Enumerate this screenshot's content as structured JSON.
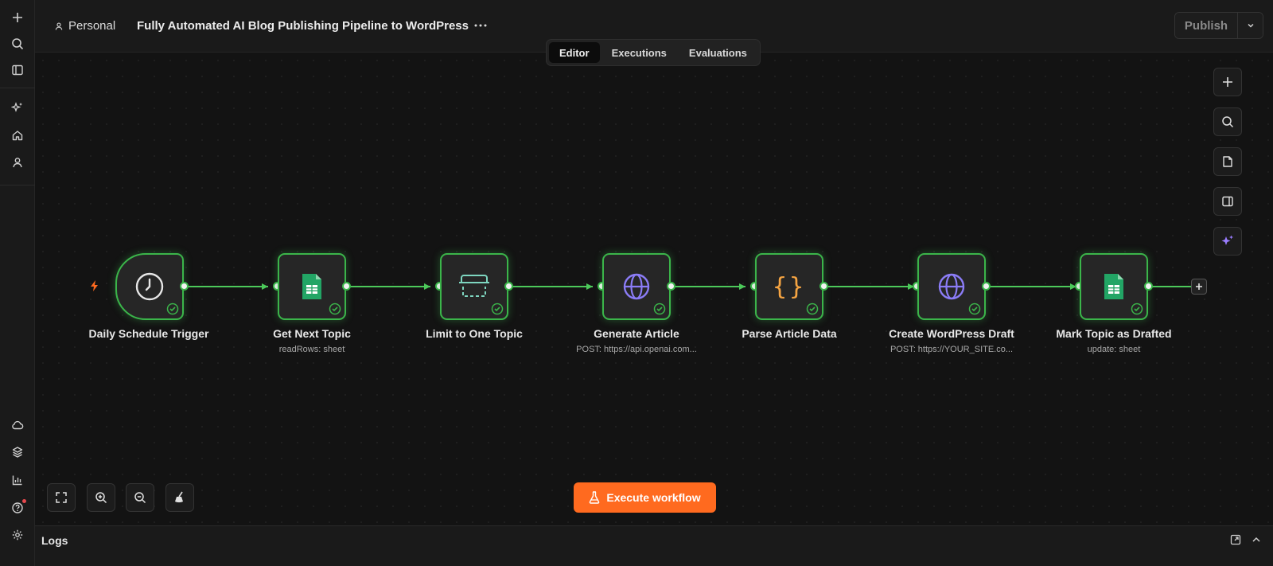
{
  "header": {
    "project_label": "Personal",
    "workflow_title": "Fully Automated AI Blog Publishing Pipeline to WordPress",
    "publish_label": "Publish"
  },
  "tabs": [
    {
      "label": "Editor",
      "active": true
    },
    {
      "label": "Executions",
      "active": false
    },
    {
      "label": "Evaluations",
      "active": false
    }
  ],
  "nodes": [
    {
      "label": "Daily Schedule Trigger",
      "subtitle": "",
      "icon": "clock-icon",
      "status": "success"
    },
    {
      "label": "Get Next Topic",
      "subtitle": "readRows: sheet",
      "icon": "google-sheets-icon",
      "status": "success"
    },
    {
      "label": "Limit to One Topic",
      "subtitle": "",
      "icon": "limit-icon",
      "status": "success"
    },
    {
      "label": "Generate Article",
      "subtitle": "POST: https://api.openai.com...",
      "icon": "globe-icon",
      "status": "success"
    },
    {
      "label": "Parse Article Data",
      "subtitle": "",
      "icon": "code-braces-icon",
      "status": "success"
    },
    {
      "label": "Create WordPress Draft",
      "subtitle": "POST: https://YOUR_SITE.co...",
      "icon": "globe-icon",
      "status": "success"
    },
    {
      "label": "Mark Topic as Drafted",
      "subtitle": "update: sheet",
      "icon": "google-sheets-icon",
      "status": "success"
    }
  ],
  "execute_label": "Execute workflow",
  "logs_label": "Logs",
  "colors": {
    "accent_orange": "#ff6a1f",
    "success_green": "#3bb54a",
    "globe_purple": "#8b7cf6",
    "braces_orange": "#f5a442",
    "sheets_green": "#22a565",
    "limit_teal": "#7ed6c0"
  }
}
